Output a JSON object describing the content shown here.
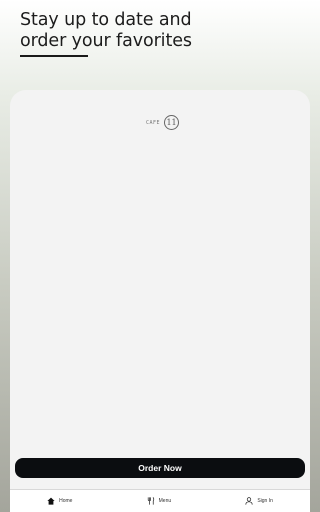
{
  "header": {
    "headline_line1": "Stay up to date and",
    "headline_line2": "order your favorites"
  },
  "card": {
    "logo_text": "CAFE",
    "logo_mark": "11"
  },
  "actions": {
    "order_now_label": "Order Now"
  },
  "nav": {
    "items": [
      {
        "label": "Home",
        "icon": "home-icon"
      },
      {
        "label": "Menu",
        "icon": "fork-knife-icon"
      },
      {
        "label": "Sign In",
        "icon": "user-icon"
      }
    ]
  },
  "colors": {
    "button_bg": "#0b0d10",
    "headline_text": "#1c1c1c",
    "card_bg": "#f3f3f3"
  }
}
